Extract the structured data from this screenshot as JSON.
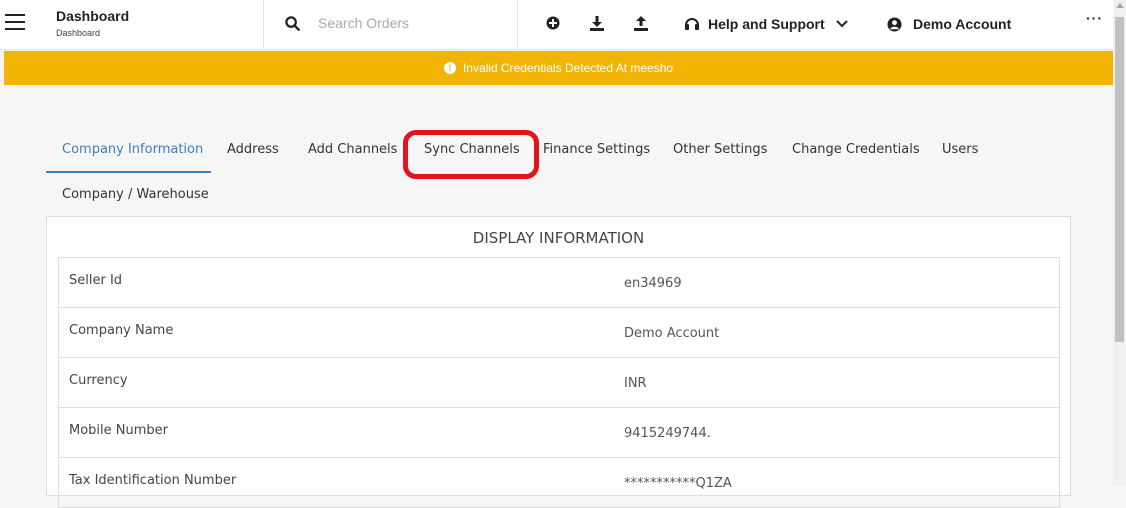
{
  "header": {
    "title": "Dashboard",
    "subtitle": "Dashboard",
    "search_placeholder": "Search Orders",
    "help_label": "Help and Support",
    "account_label": "Demo Account",
    "more_label": "···"
  },
  "alert": {
    "message": "Invalid Credentials Detected At meesho",
    "color": "#f3b505"
  },
  "tabs": [
    {
      "label": "Company Information",
      "active": true
    },
    {
      "label": "Address"
    },
    {
      "label": "Add Channels"
    },
    {
      "label": "Sync Channels"
    },
    {
      "label": "Finance Settings"
    },
    {
      "label": "Other Settings"
    },
    {
      "label": "Change Credentials"
    },
    {
      "label": "Users"
    },
    {
      "label": "Company / Warehouse"
    }
  ],
  "display_info": {
    "title": "DISPLAY INFORMATION",
    "rows": [
      {
        "label": "Seller Id",
        "value": "en34969"
      },
      {
        "label": "Company Name",
        "value": "Demo Account"
      },
      {
        "label": "Currency",
        "value": "INR"
      },
      {
        "label": "Mobile Number",
        "value": "9415249744."
      },
      {
        "label": "Tax Identification Number",
        "value": "***********Q1ZA"
      }
    ]
  },
  "colors": {
    "accent": "#3e7fbf",
    "highlight": "#e5141c"
  }
}
